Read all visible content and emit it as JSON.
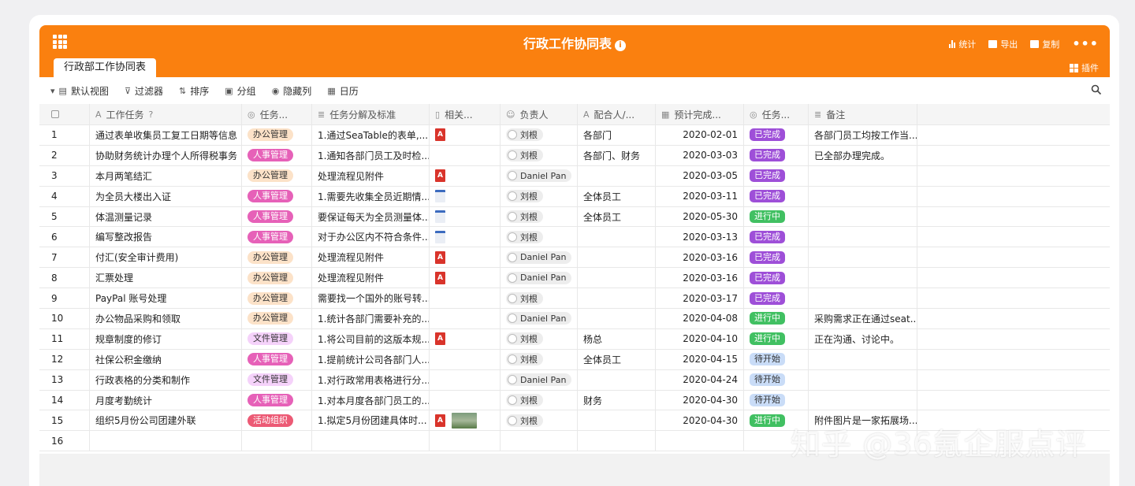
{
  "header": {
    "title": "行政工作协同表",
    "tab": "行政部工作协同表",
    "actions": {
      "stats": "统计",
      "export": "导出",
      "copy": "复制",
      "more": "•••"
    },
    "plugin": "插件"
  },
  "toolbar": {
    "view": "默认视图",
    "filter": "过滤器",
    "sort": "排序",
    "group": "分组",
    "hide": "隐藏列",
    "calendar": "日历"
  },
  "columns": [
    "工作任务",
    "任务...",
    "任务分解及标准",
    "相关...",
    "负责人",
    "配合人/...",
    "预计完成...",
    "任务...",
    "备注"
  ],
  "rows": [
    {
      "num": "1",
      "task": "通过表单收集员工复工日期等信息",
      "type": "办公管理",
      "detail": "1.通过SeaTable的表单,...",
      "file": "pdf",
      "owner": "刘根",
      "helper": "各部门",
      "date": "2020-02-01",
      "status": "已完成",
      "note": "各部门员工均按工作当..."
    },
    {
      "num": "2",
      "task": "协助财务统计办理个人所得税事务",
      "type": "人事管理",
      "detail": "1.通知各部门员工及时检...",
      "file": "",
      "owner": "刘根",
      "helper": "各部门、财务",
      "date": "2020-03-03",
      "status": "已完成",
      "note": "已全部办理完成。"
    },
    {
      "num": "3",
      "task": "本月两笔结汇",
      "type": "办公管理",
      "detail": "处理流程见附件",
      "file": "pdf",
      "owner": "Daniel Pan",
      "helper": "",
      "date": "2020-03-05",
      "status": "已完成",
      "note": ""
    },
    {
      "num": "4",
      "task": "为全员大楼出入证",
      "type": "人事管理",
      "detail": "1.需要先收集全员近期情...",
      "file": "doc",
      "owner": "刘根",
      "helper": "全体员工",
      "date": "2020-03-11",
      "status": "已完成",
      "note": ""
    },
    {
      "num": "5",
      "task": "体温测量记录",
      "type": "人事管理",
      "detail": "要保证每天为全员测量体...",
      "file": "doc",
      "owner": "刘根",
      "helper": "全体员工",
      "date": "2020-05-30",
      "status": "进行中",
      "note": ""
    },
    {
      "num": "6",
      "task": "编写整改报告",
      "type": "人事管理",
      "detail": "对于办公区内不符合条件...",
      "file": "doc",
      "owner": "刘根",
      "helper": "",
      "date": "2020-03-13",
      "status": "已完成",
      "note": ""
    },
    {
      "num": "7",
      "task": "付汇(安全审计费用)",
      "type": "办公管理",
      "detail": "处理流程见附件",
      "file": "pdf",
      "owner": "Daniel Pan",
      "helper": "",
      "date": "2020-03-16",
      "status": "已完成",
      "note": ""
    },
    {
      "num": "8",
      "task": "汇票处理",
      "type": "办公管理",
      "detail": "处理流程见附件",
      "file": "pdf",
      "owner": "Daniel Pan",
      "helper": "",
      "date": "2020-03-16",
      "status": "已完成",
      "note": ""
    },
    {
      "num": "9",
      "task": "PayPal 账号处理",
      "type": "办公管理",
      "detail": "需要找一个国外的账号转...",
      "file": "",
      "owner": "刘根",
      "helper": "",
      "date": "2020-03-17",
      "status": "已完成",
      "note": ""
    },
    {
      "num": "10",
      "task": "办公物品采购和领取",
      "type": "办公管理",
      "detail": "1.统计各部门需要补充的...",
      "file": "",
      "owner": "Daniel Pan",
      "helper": "",
      "date": "2020-04-08",
      "status": "进行中",
      "note": "采购需求正在通过seat..."
    },
    {
      "num": "11",
      "task": "规章制度的修订",
      "type": "文件管理",
      "detail": "1.将公司目前的这版本规...",
      "file": "pdf",
      "owner": "刘根",
      "helper": "杨总",
      "date": "2020-04-10",
      "status": "进行中",
      "note": "正在沟通、讨论中。"
    },
    {
      "num": "12",
      "task": "社保公积金缴纳",
      "type": "人事管理",
      "detail": "1.提前统计公司各部门人...",
      "file": "",
      "owner": "刘根",
      "helper": "全体员工",
      "date": "2020-04-15",
      "status": "待开始",
      "note": ""
    },
    {
      "num": "13",
      "task": "行政表格的分类和制作",
      "type": "文件管理",
      "detail": "1.对行政常用表格进行分...",
      "file": "",
      "owner": "Daniel Pan",
      "helper": "",
      "date": "2020-04-24",
      "status": "待开始",
      "note": ""
    },
    {
      "num": "14",
      "task": "月度考勤统计",
      "type": "人事管理",
      "detail": "1.对本月度各部门员工的...",
      "file": "",
      "owner": "刘根",
      "helper": "财务",
      "date": "2020-04-30",
      "status": "待开始",
      "note": ""
    },
    {
      "num": "15",
      "task": "组织5月份公司团建外联",
      "type": "活动组织",
      "detail": "1.拟定5月份团建具体时...",
      "file": "pdf+img",
      "owner": "刘根",
      "helper": "",
      "date": "2020-04-30",
      "status": "进行中",
      "note": "附件图片是一家拓展场..."
    },
    {
      "num": "16",
      "task": "",
      "type": "",
      "detail": "",
      "file": "",
      "owner": "",
      "helper": "",
      "date": "",
      "status": "",
      "note": ""
    }
  ],
  "watermark": "知乎 @36氪企服点评"
}
